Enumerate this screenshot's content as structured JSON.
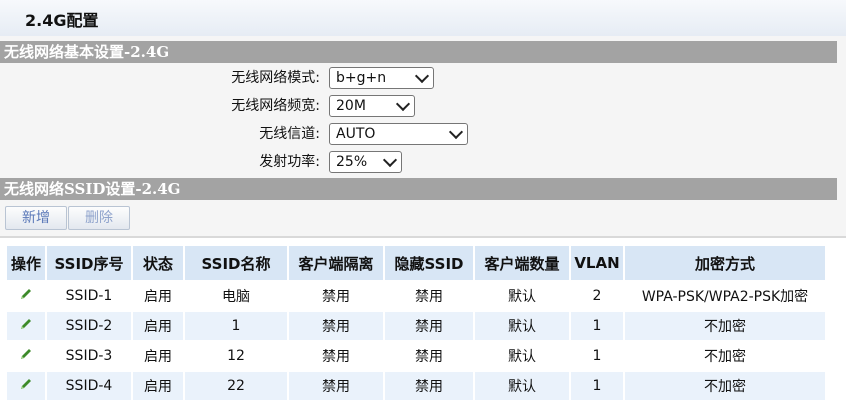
{
  "header": {
    "title": "2.4G配置"
  },
  "basic_section": {
    "title": "无线网络基本设置-2.4G",
    "fields": [
      {
        "label": "无线网络模式:",
        "value": "b+g+n"
      },
      {
        "label": "无线网络频宽:",
        "value": "20M"
      },
      {
        "label": "无线信道:",
        "value": "AUTO"
      },
      {
        "label": "发射功率:",
        "value": "25%"
      }
    ]
  },
  "ssid_section": {
    "title": "无线网络SSID设置-2.4G",
    "add_label": "新增",
    "delete_label": "删除"
  },
  "table": {
    "headers": [
      "操作",
      "SSID序号",
      "状态",
      "SSID名称",
      "客户端隔离",
      "隐藏SSID",
      "客户端数量",
      "VLAN",
      "加密方式"
    ],
    "rows": [
      {
        "ssid": "SSID-1",
        "status": "启用",
        "name": "电脑",
        "isolation": "禁用",
        "hidden": "禁用",
        "clients": "默认",
        "vlan": "2",
        "encryption": "WPA-PSK/WPA2-PSK加密"
      },
      {
        "ssid": "SSID-2",
        "status": "启用",
        "name": "1",
        "isolation": "禁用",
        "hidden": "禁用",
        "clients": "默认",
        "vlan": "1",
        "encryption": "不加密"
      },
      {
        "ssid": "SSID-3",
        "status": "启用",
        "name": "12",
        "isolation": "禁用",
        "hidden": "禁用",
        "clients": "默认",
        "vlan": "1",
        "encryption": "不加密"
      },
      {
        "ssid": "SSID-4",
        "status": "启用",
        "name": "22",
        "isolation": "禁用",
        "hidden": "禁用",
        "clients": "默认",
        "vlan": "1",
        "encryption": "不加密"
      }
    ],
    "edit_icon": "pencil-icon"
  },
  "colors": {
    "section_bar": "#a3a3a3",
    "table_header": "#d8e6f5",
    "row_alt": "#eaf2fb",
    "edit_icon": "#3d8a2a"
  }
}
